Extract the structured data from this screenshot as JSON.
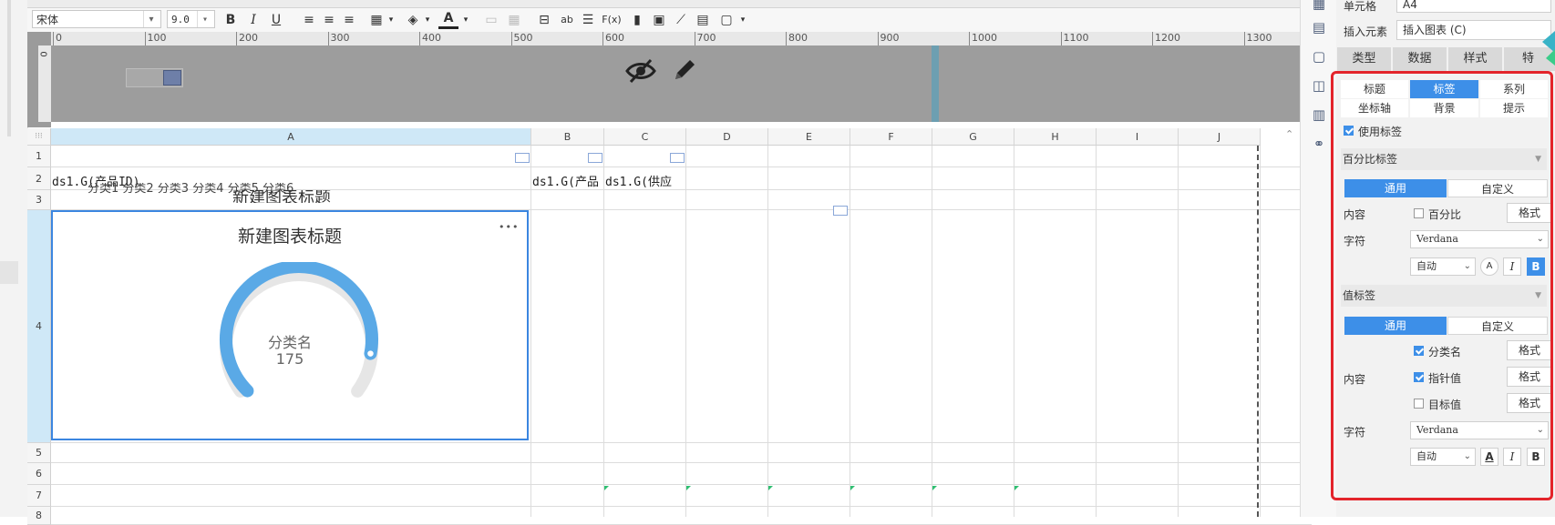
{
  "toolbar": {
    "font_name": "宋体",
    "font_size": "9.0",
    "bold": "B",
    "italic": "I",
    "underline": "U",
    "text_color_glyph": "A",
    "abc_glyph": "ab",
    "fx_glyph": "F(x)"
  },
  "ruler": {
    "ticks": [
      "0",
      "100",
      "200",
      "300",
      "400",
      "500",
      "600",
      "700",
      "800",
      "900",
      "1000",
      "1100",
      "1200",
      "1300"
    ]
  },
  "vruler_label": "0",
  "columns": [
    "A",
    "B",
    "C",
    "D",
    "E",
    "F",
    "G",
    "H",
    "I",
    "J"
  ],
  "rows": [
    "1",
    "2",
    "3",
    "4",
    "5",
    "6",
    "7",
    "8"
  ],
  "cells": {
    "a2": "ds1.G(产品ID)",
    "b2": "ds1.G(产品",
    "c2": "ds1.G(供应",
    "row3_categories": "分类1   分类2   分类3   分类4   分类5   分类6",
    "row3_title": "新建图表标题"
  },
  "chart_data": {
    "type": "gauge",
    "title": "新建图表标题",
    "category_label": "分类名",
    "value": 175,
    "more_glyph": "•••",
    "colors": {
      "arc": "#5aa9e6",
      "track": "#e6e6e6"
    }
  },
  "panel": {
    "cell_label": "单元格",
    "cell_value": "A4",
    "insert_label": "插入元素",
    "insert_value": "插入图表 (C)",
    "tabs": [
      "类型",
      "数据",
      "样式",
      "特"
    ],
    "subtabs_row1": [
      "标题",
      "标签",
      "系列"
    ],
    "subtabs_row2": [
      "坐标轴",
      "背景",
      "提示"
    ],
    "use_label": "使用标签",
    "percent_section": "百分比标签",
    "seg_general": "通用",
    "seg_custom": "自定义",
    "content_label": "内容",
    "percent_option": "百分比",
    "format_btn": "格式",
    "char_label": "字符",
    "font_value": "Verdana",
    "auto_value": "自动",
    "value_section": "值标签",
    "opt_category": "分类名",
    "opt_pointer": "指针值",
    "opt_target": "目标值",
    "italic_glyph": "I",
    "bold_glyph": "B",
    "color_glyph": "A"
  }
}
